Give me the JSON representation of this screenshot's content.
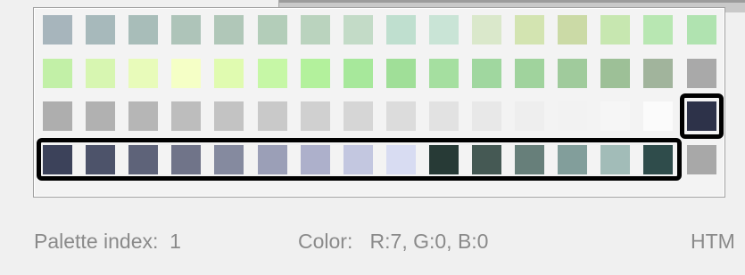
{
  "palette": {
    "rows": [
      [
        "#a7b5bc",
        "#a7b9bb",
        "#a8bdb9",
        "#aec4b9",
        "#b0c7b8",
        "#b3cdb9",
        "#bad3be",
        "#c3dbc7",
        "#bfdfcf",
        "#c9e4d6",
        "#dae8cb",
        "#d3e4b1",
        "#cbdaa6",
        "#c7e7b0",
        "#b8e7b2",
        "#b0e3b0"
      ],
      [
        "#c2f0a7",
        "#d7f6b1",
        "#e8fbba",
        "#f5ffc6",
        "#e0fbb0",
        "#c6f7a6",
        "#b3f19c",
        "#a7e89b",
        "#a0df98",
        "#a5dfa0",
        "#a0d79f",
        "#a0d39d",
        "#a0cb9c",
        "#9dc097",
        "#a1b49c",
        "#a9a9a9"
      ],
      [
        "#aeaeae",
        "#b1b1b1",
        "#b6b6b6",
        "#bdbdbd",
        "#c3c3c3",
        "#c9c9c9",
        "#d0d0d0",
        "#d6d6d6",
        "#dcdcdc",
        "#e2e2e2",
        "#e8e8e8",
        "#eeeeee",
        "#f2f2f2",
        "#f6f6f6",
        "#fbfbfb",
        "#2d3249"
      ],
      [
        "#3c425a",
        "#4d536a",
        "#5e6379",
        "#707489",
        "#858a9f",
        "#9b9fb7",
        "#adb0cb",
        "#c3c7e0",
        "#d8dcf2",
        "#273a36",
        "#455954",
        "#677f7a",
        "#829e9b",
        "#a2bcb8",
        "#2f4c4b",
        "#a8a8a8"
      ]
    ]
  },
  "status": {
    "index_text": "Palette index:  1",
    "color_text": "Color:   R:7, G:0, B:0",
    "html_text": "HTM"
  }
}
